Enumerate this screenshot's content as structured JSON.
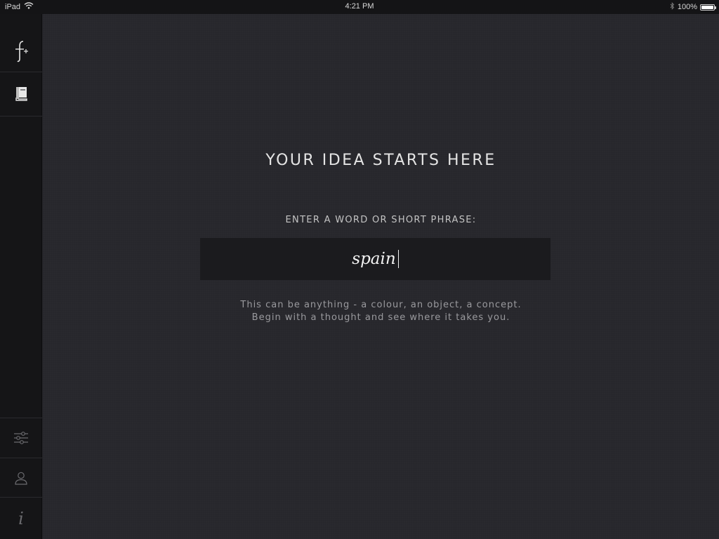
{
  "status_bar": {
    "device": "iPad",
    "time": "4:21 PM",
    "battery_percent": "100%",
    "battery_level": 1.0,
    "icons": [
      "wifi-icon",
      "bluetooth-icon",
      "battery-icon"
    ]
  },
  "sidebar": {
    "top_items": [
      {
        "name": "new-idea",
        "icon": "pen-plus-icon"
      },
      {
        "name": "library",
        "icon": "book-icon"
      }
    ],
    "bottom_items": [
      {
        "name": "settings",
        "icon": "sliders-icon"
      },
      {
        "name": "profile",
        "icon": "user-icon"
      },
      {
        "name": "info",
        "icon": "info-icon"
      }
    ]
  },
  "main": {
    "headline": "YOUR IDEA STARTS HERE",
    "prompt_label": "ENTER A WORD OR SHORT PHRASE:",
    "input_value": "spain",
    "helper_line1": "This can be anything - a colour, an object, a concept.",
    "helper_line2": "Begin with a thought and see where it takes you."
  },
  "colors": {
    "background": "#28282d",
    "sidebar": "#151517",
    "input_background": "#1b1b1e",
    "text_primary": "#e4e4e4",
    "text_secondary": "#9a9a9e"
  }
}
